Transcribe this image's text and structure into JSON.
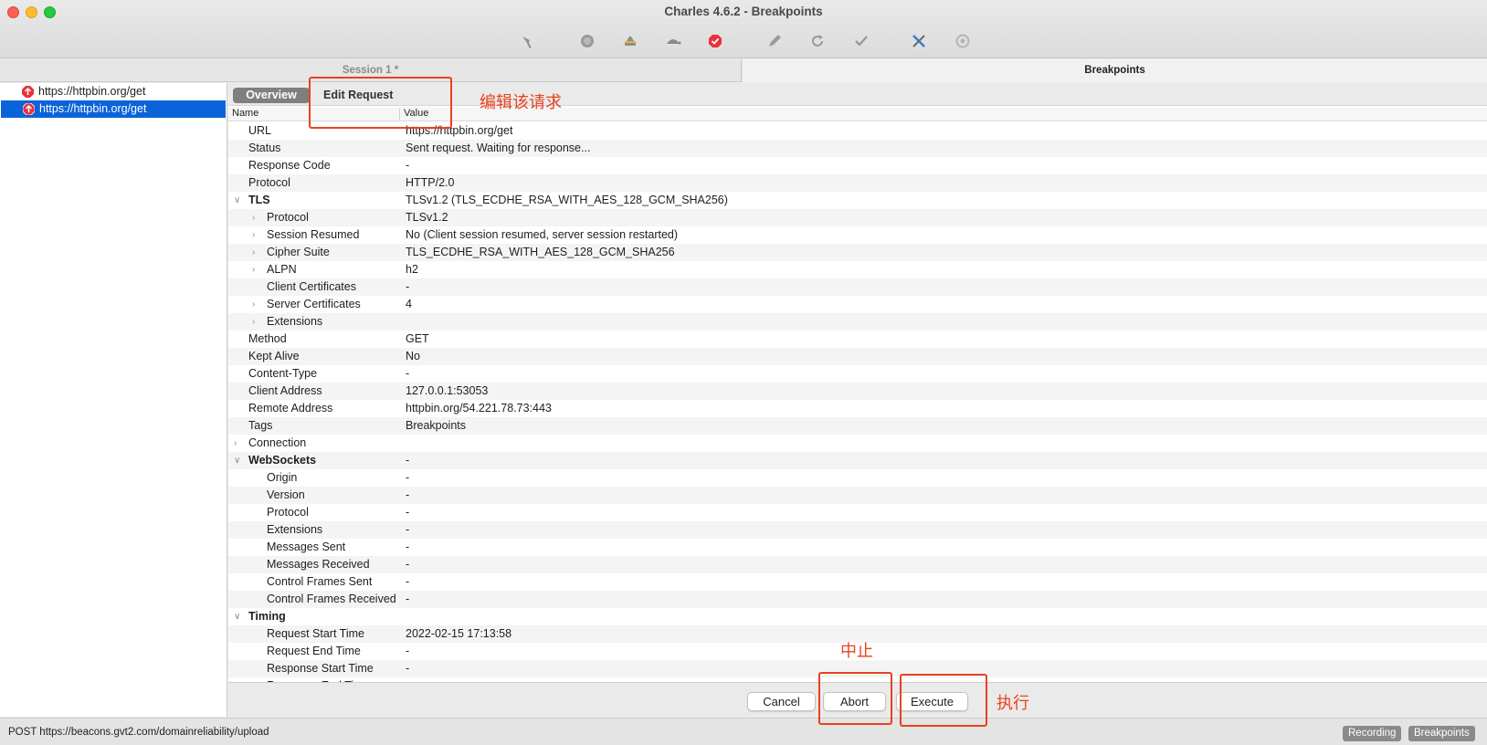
{
  "window": {
    "title": "Charles 4.6.2 - Breakpoints"
  },
  "toolbar": {
    "icons": [
      "broom-icon",
      "record-icon",
      "throttle-icon",
      "turtle-icon",
      "breakpoint-icon",
      "pen-icon",
      "refresh-icon",
      "check-icon",
      "tools-icon",
      "settings-icon"
    ]
  },
  "tabs": {
    "session": "Session 1 *",
    "breakpoints": "Breakpoints"
  },
  "left_list": {
    "items": [
      {
        "label": "https://httpbin.org/get",
        "selected": false
      },
      {
        "label": "https://httpbin.org/get",
        "selected": true
      }
    ]
  },
  "subtabs": {
    "overview": "Overview",
    "edit_request": "Edit Request"
  },
  "columns": {
    "name": "Name",
    "value": "Value"
  },
  "rows": [
    {
      "name": "URL",
      "value": "https://httpbin.org/get",
      "level": 1
    },
    {
      "name": "Status",
      "value": "Sent request. Waiting for response...",
      "level": 1
    },
    {
      "name": "Response Code",
      "value": "-",
      "level": 1
    },
    {
      "name": "Protocol",
      "value": "HTTP/2.0",
      "level": 1
    },
    {
      "name": "TLS",
      "value": "TLSv1.2 (TLS_ECDHE_RSA_WITH_AES_128_GCM_SHA256)",
      "level": 1,
      "bold": true,
      "toggle": "open"
    },
    {
      "name": "Protocol",
      "value": "TLSv1.2",
      "level": 2,
      "toggle": "closed"
    },
    {
      "name": "Session Resumed",
      "value": "No (Client session resumed, server session restarted)",
      "level": 2,
      "toggle": "closed"
    },
    {
      "name": "Cipher Suite",
      "value": "TLS_ECDHE_RSA_WITH_AES_128_GCM_SHA256",
      "level": 2,
      "toggle": "closed"
    },
    {
      "name": "ALPN",
      "value": "h2",
      "level": 2,
      "toggle": "closed"
    },
    {
      "name": "Client Certificates",
      "value": "-",
      "level": 2
    },
    {
      "name": "Server Certificates",
      "value": "4",
      "level": 2,
      "toggle": "closed"
    },
    {
      "name": "Extensions",
      "value": "",
      "level": 2,
      "toggle": "closed"
    },
    {
      "name": "Method",
      "value": "GET",
      "level": 1
    },
    {
      "name": "Kept Alive",
      "value": "No",
      "level": 1
    },
    {
      "name": "Content-Type",
      "value": "-",
      "level": 1
    },
    {
      "name": "Client Address",
      "value": "127.0.0.1:53053",
      "level": 1
    },
    {
      "name": "Remote Address",
      "value": "httpbin.org/54.221.78.73:443",
      "level": 1
    },
    {
      "name": "Tags",
      "value": "Breakpoints",
      "level": 1
    },
    {
      "name": "Connection",
      "value": "",
      "level": 1,
      "toggle": "closed"
    },
    {
      "name": "WebSockets",
      "value": "-",
      "level": 1,
      "bold": true,
      "toggle": "open"
    },
    {
      "name": "Origin",
      "value": "-",
      "level": 2
    },
    {
      "name": "Version",
      "value": "-",
      "level": 2
    },
    {
      "name": "Protocol",
      "value": "-",
      "level": 2
    },
    {
      "name": "Extensions",
      "value": "-",
      "level": 2
    },
    {
      "name": "Messages Sent",
      "value": "-",
      "level": 2
    },
    {
      "name": "Messages Received",
      "value": "-",
      "level": 2
    },
    {
      "name": "Control Frames Sent",
      "value": "-",
      "level": 2
    },
    {
      "name": "Control Frames Received",
      "value": "-",
      "level": 2
    },
    {
      "name": "Timing",
      "value": "",
      "level": 1,
      "bold": true,
      "toggle": "open"
    },
    {
      "name": "Request Start Time",
      "value": "2022-02-15 17:13:58",
      "level": 2
    },
    {
      "name": "Request End Time",
      "value": "-",
      "level": 2
    },
    {
      "name": "Response Start Time",
      "value": "-",
      "level": 2
    },
    {
      "name": "Response End Time",
      "value": "-",
      "level": 2
    }
  ],
  "actions": {
    "cancel": "Cancel",
    "abort": "Abort",
    "execute": "Execute"
  },
  "statusbar": {
    "text": "POST https://beacons.gvt2.com/domainreliability/upload",
    "recording": "Recording",
    "breakpoints": "Breakpoints"
  },
  "annotations": {
    "edit_request": "编辑该请求",
    "abort": "中止",
    "execute": "执行"
  },
  "colors": {
    "selection": "#0a63d9",
    "annotation": "#e8411f",
    "breakpoint_red": "#e8323c"
  }
}
